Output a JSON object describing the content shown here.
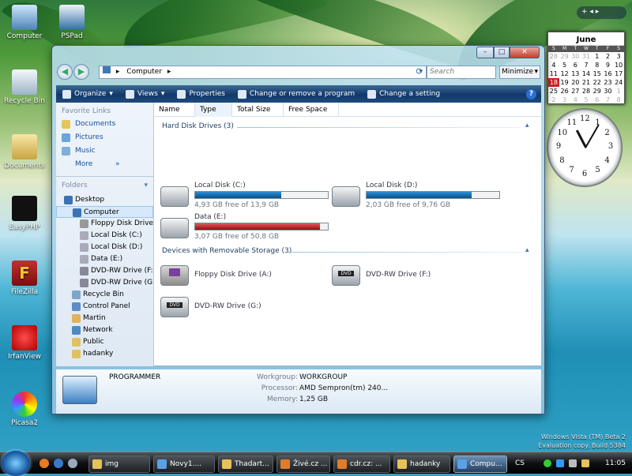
{
  "desktop_icons": [
    {
      "label": "Computer"
    },
    {
      "label": "PSPad"
    },
    {
      "label": "Recycle Bin"
    },
    {
      "label": "Documents"
    },
    {
      "label": "EasyPHP"
    },
    {
      "label": "FileZilla"
    },
    {
      "label": "IrfanView"
    },
    {
      "label": "Picasa2"
    }
  ],
  "window": {
    "address": "Computer",
    "address_arrow": "▸",
    "search_placeholder": "Search",
    "minimize_label": "Minimize"
  },
  "toolbar": {
    "organize": "Organize",
    "views": "Views",
    "properties": "Properties",
    "change_program": "Change or remove a program",
    "change_setting": "Change a setting",
    "help": "?"
  },
  "nav": {
    "favorite_links_title": "Favorite Links",
    "favorites": [
      "Documents",
      "Pictures",
      "Music",
      "More"
    ],
    "more_arrow": "»",
    "folders_title": "Folders",
    "tree": [
      "Desktop",
      "Computer",
      "Floppy Disk Drive",
      "Local Disk (C:)",
      "Local Disk (D:)",
      "Data (E:)",
      "DVD-RW Drive (F:)",
      "DVD-RW Drive (G:)",
      "Recycle Bin",
      "Control Panel",
      "Martin",
      "Network",
      "Public",
      "hadanky"
    ]
  },
  "columns": [
    "Name",
    "Type",
    "Total Size",
    "Free Space"
  ],
  "groups": {
    "hard_disks": "Hard Disk Drives (3)",
    "removable": "Devices with Removable Storage (3)"
  },
  "drives": [
    {
      "name": "Local Disk (C:)",
      "free": "4,93 GB free of 13,9 GB",
      "used_fraction": 0.65,
      "bar_color": "#2a8fd6"
    },
    {
      "name": "Local Disk (D:)",
      "free": "2,03 GB free of 9,76 GB",
      "used_fraction": 0.79,
      "bar_color": "#2a8fd6"
    },
    {
      "name": "Data (E:)",
      "free": "3,07 GB free of 50,8 GB",
      "used_fraction": 0.94,
      "bar_color": "#c8262a"
    }
  ],
  "removable": [
    {
      "name": "Floppy Disk Drive (A:)"
    },
    {
      "name": "DVD-RW Drive (F:)",
      "badge": "DVD"
    },
    {
      "name": "DVD-RW Drive (G:)",
      "badge": "DVD"
    }
  ],
  "details": {
    "computer_name": "PROGRAMMER",
    "workgroup_label": "Workgroup:",
    "workgroup": "WORKGROUP",
    "processor_label": "Processor:",
    "processor": "AMD Sempron(tm) 240...",
    "memory_label": "Memory:",
    "memory": "1,25 GB"
  },
  "calendar": {
    "month": "June",
    "dow": [
      "S",
      "M",
      "T",
      "W",
      "T",
      "F",
      "S"
    ],
    "weeks": [
      [
        "28",
        "29",
        "30",
        "31",
        "1",
        "2",
        "3"
      ],
      [
        "4",
        "5",
        "6",
        "7",
        "8",
        "9",
        "10"
      ],
      [
        "11",
        "12",
        "13",
        "14",
        "15",
        "16",
        "17"
      ],
      [
        "18",
        "19",
        "20",
        "21",
        "22",
        "23",
        "24"
      ],
      [
        "25",
        "26",
        "27",
        "28",
        "29",
        "30",
        "1"
      ],
      [
        "2",
        "3",
        "4",
        "5",
        "6",
        "7",
        "8"
      ]
    ],
    "today": "18"
  },
  "clock": {
    "hour": 11,
    "minute": 5,
    "numerals": [
      "12",
      "1",
      "2",
      "3",
      "4",
      "5",
      "6",
      "7",
      "8",
      "9",
      "10",
      "11"
    ]
  },
  "sidebar_controls": "+   ◂ ▸",
  "watermark": {
    "line1": "Windows Vista (TM) Beta 2",
    "line2": "Evaluation copy. Build 5384"
  },
  "taskbar": {
    "tasks": [
      {
        "label": "img",
        "color": "#e6c25a"
      },
      {
        "label": "Novy1....",
        "color": "#5aa0e6"
      },
      {
        "label": "Thadart...",
        "color": "#e6c25a"
      },
      {
        "label": "Živé.cz ...",
        "color": "#e07b2a"
      },
      {
        "label": "cdr.cz: ...",
        "color": "#e07b2a"
      },
      {
        "label": "hadanky",
        "color": "#e6c25a"
      },
      {
        "label": "Compu...",
        "color": "#5aa0e6"
      }
    ],
    "lang": "CS",
    "time": "11:05"
  }
}
